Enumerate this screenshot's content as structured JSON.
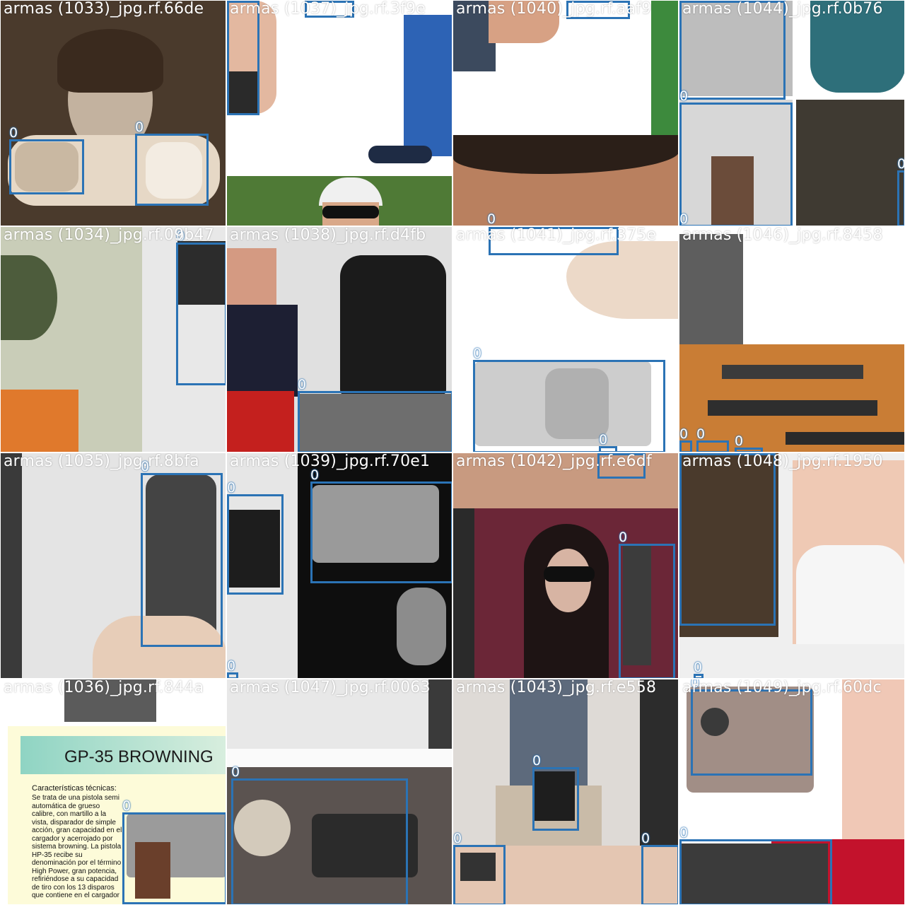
{
  "bbox_label": "0",
  "box_color": "#2b73b5",
  "tiles": [
    {
      "title": "armas (1033)_jpg.rf.66de"
    },
    {
      "title": "armas (1037)_jpg.rf.3f9e"
    },
    {
      "title": "armas (1040)_jpg.rf.aaf9"
    },
    {
      "title": "armas (1044)_jpg.rf.0b76"
    },
    {
      "title": "armas (1034)_jpg.rf.09b47"
    },
    {
      "title": "armas (1038)_jpg.rf.d4fb"
    },
    {
      "title": "armas (1041)_jpg.rf.375e"
    },
    {
      "title": "armas (1046)_jpg.rf.8458"
    },
    {
      "title": "armas (1035)_jpg.rf.8bfa"
    },
    {
      "title": "armas (1039)_jpg.rf.70e1"
    },
    {
      "title": "armas (1042)_jpg.rf.e6df"
    },
    {
      "title": "armas (1048)_jpg.rf.1950"
    },
    {
      "title": "armas (1036)_jpg.rf.844a"
    },
    {
      "title": "armas (1047)_jpg.rf.0063"
    },
    {
      "title": "armas (1043)_jpg.rf.e558"
    },
    {
      "title": "armas (1049)_jpg.rf.60dc"
    }
  ],
  "document": {
    "heading": "GP-35 BROWNING",
    "bullet_title": "Características técnicas:",
    "body": "Se trata de una pistola semi automática de grueso calibre, con martillo a la vista, disparador de simple acción, gran capacidad en el cargador y acerrojado por sistema browning. La pistola HP-35 recibe su denominación por el término High Power, gran potencia, refiriéndose a su capacidad de tiro con los 13 disparos que contiene en el cargador y no por que entregue más energía que otras armas de mismo calibre. También era común ver que se le nombre"
  }
}
